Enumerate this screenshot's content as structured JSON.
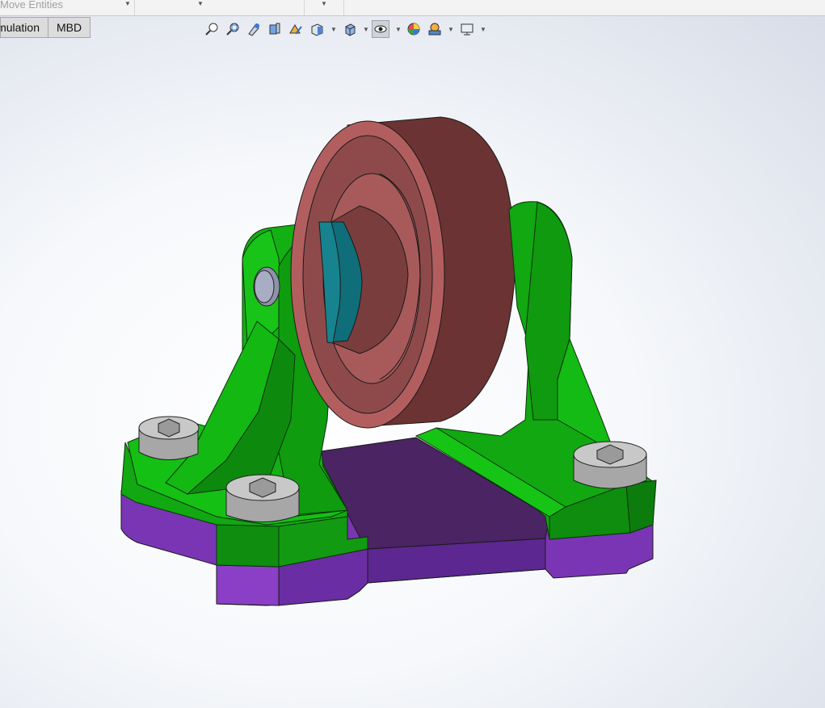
{
  "command_bar": {
    "move_entities_label": "Move Entities"
  },
  "tabs": [
    {
      "label": "Simulation"
    },
    {
      "label": "MBD"
    }
  ],
  "headsup_toolbar": [
    {
      "icon": "zoom-to-fit-icon"
    },
    {
      "icon": "zoom-to-area-icon"
    },
    {
      "icon": "previous-view-icon"
    },
    {
      "icon": "section-view-icon"
    },
    {
      "icon": "dynamic-annotation-icon"
    },
    {
      "icon": "view-orientation-icon"
    },
    {
      "icon": "display-style-icon"
    },
    {
      "icon": "hide-show-items-icon"
    },
    {
      "icon": "edit-appearance-icon"
    },
    {
      "icon": "apply-scene-icon"
    },
    {
      "icon": "view-settings-icon"
    }
  ],
  "colors": {
    "bracket_green": "#12b012",
    "base_purple": "#6a2fa0",
    "wheel_red": "#6b3333",
    "bushing_teal": "#0f6e7a",
    "bolt_gray": "#b5b5b5",
    "viewport_bg": "#e3e7ef"
  }
}
